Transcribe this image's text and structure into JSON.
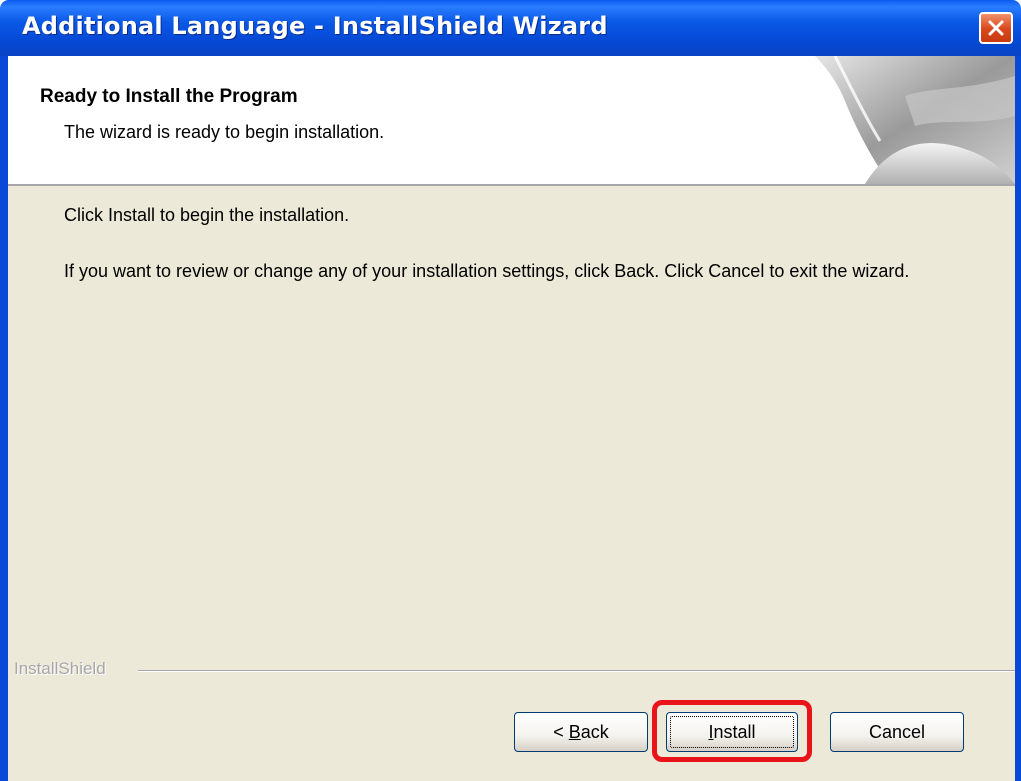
{
  "window": {
    "title": "Additional Language - InstallShield Wizard",
    "close_icon": "close-icon"
  },
  "header": {
    "title": "Ready to Install the Program",
    "subtitle": "The wizard is ready to begin installation."
  },
  "body": {
    "line1": "Click Install to begin the installation.",
    "line2": "If you want to review or change any of your installation settings, click Back. Click Cancel to exit the wizard."
  },
  "footer": {
    "brand": "InstallShield",
    "buttons": {
      "back_prefix": "< ",
      "back_mnemonic": "B",
      "back_rest": "ack",
      "install_mnemonic": "I",
      "install_rest": "nstall",
      "cancel": "Cancel"
    }
  },
  "colors": {
    "titlebar": "#0a58e6",
    "client": "#ece9d8",
    "highlight": "#e8141a"
  }
}
